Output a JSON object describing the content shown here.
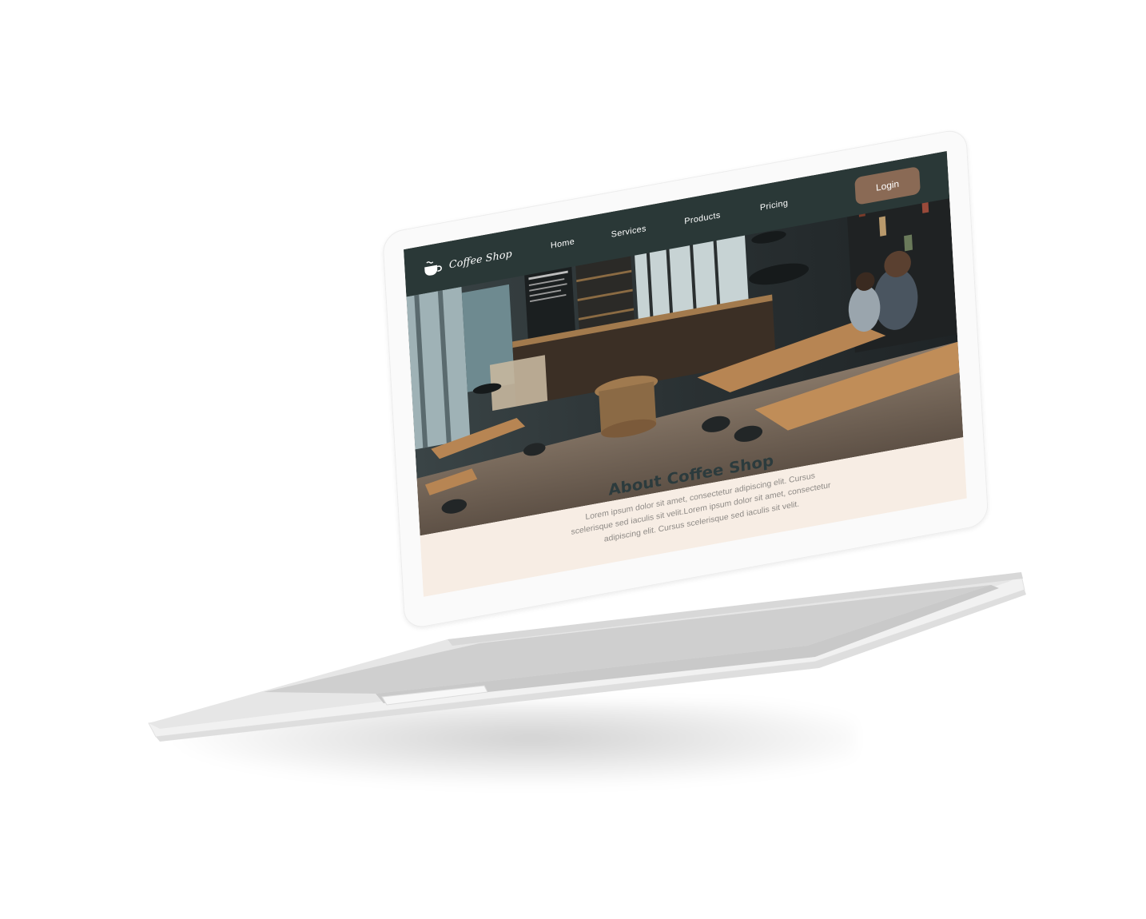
{
  "site": {
    "logo_text": "Coffee Shop",
    "logo_icon": "coffee-cup-icon"
  },
  "nav": {
    "items": [
      {
        "label": "Home"
      },
      {
        "label": "Services"
      },
      {
        "label": "Products"
      },
      {
        "label": "Pricing"
      }
    ],
    "login_label": "Login"
  },
  "hero": {
    "image": "coffee-shop-interior-photo"
  },
  "about": {
    "title": "About Coffee Shop",
    "text": "Lorem ipsum dolor sit amet, consectetur adipiscing elit. Cursus scelerisque sed iaculis sit velit.Lorem ipsum dolor sit amet, consectetur adipiscing elit. Cursus scelerisque sed iaculis sit velit."
  },
  "colors": {
    "navbar_bg": "#2a3837",
    "login_bg": "#8a6a55",
    "about_bg": "#f7ede4",
    "title_color": "#2c3b3d"
  }
}
